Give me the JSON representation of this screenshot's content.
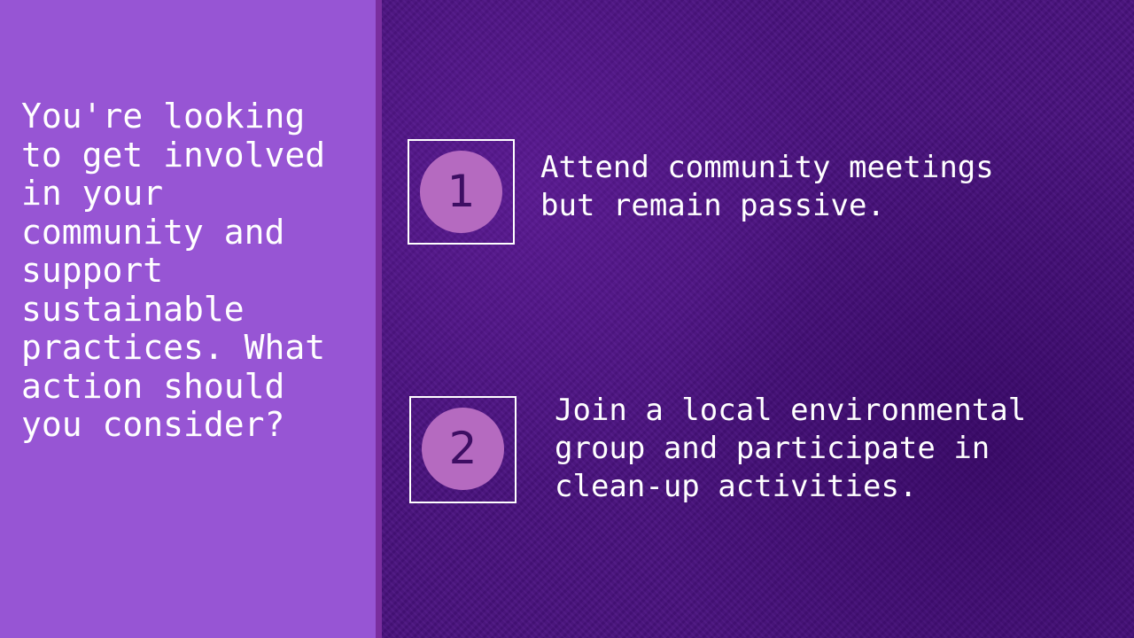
{
  "question": {
    "text": "You're looking\nto get involved\nin your\ncommunity and\nsupport\nsustainable\npractices. What\naction should\nyou consider?"
  },
  "options": [
    {
      "number": "1",
      "text": "Attend community meetings\nbut remain passive."
    },
    {
      "number": "2",
      "text": "Join a local environmental\ngroup and participate in\nclean-up activities."
    }
  ],
  "colors": {
    "left_panel": "#9755d4",
    "right_panel": "#4a1280",
    "number_circle": "#b56ac0",
    "number_text": "#3d0e63",
    "text": "#ffffff"
  }
}
